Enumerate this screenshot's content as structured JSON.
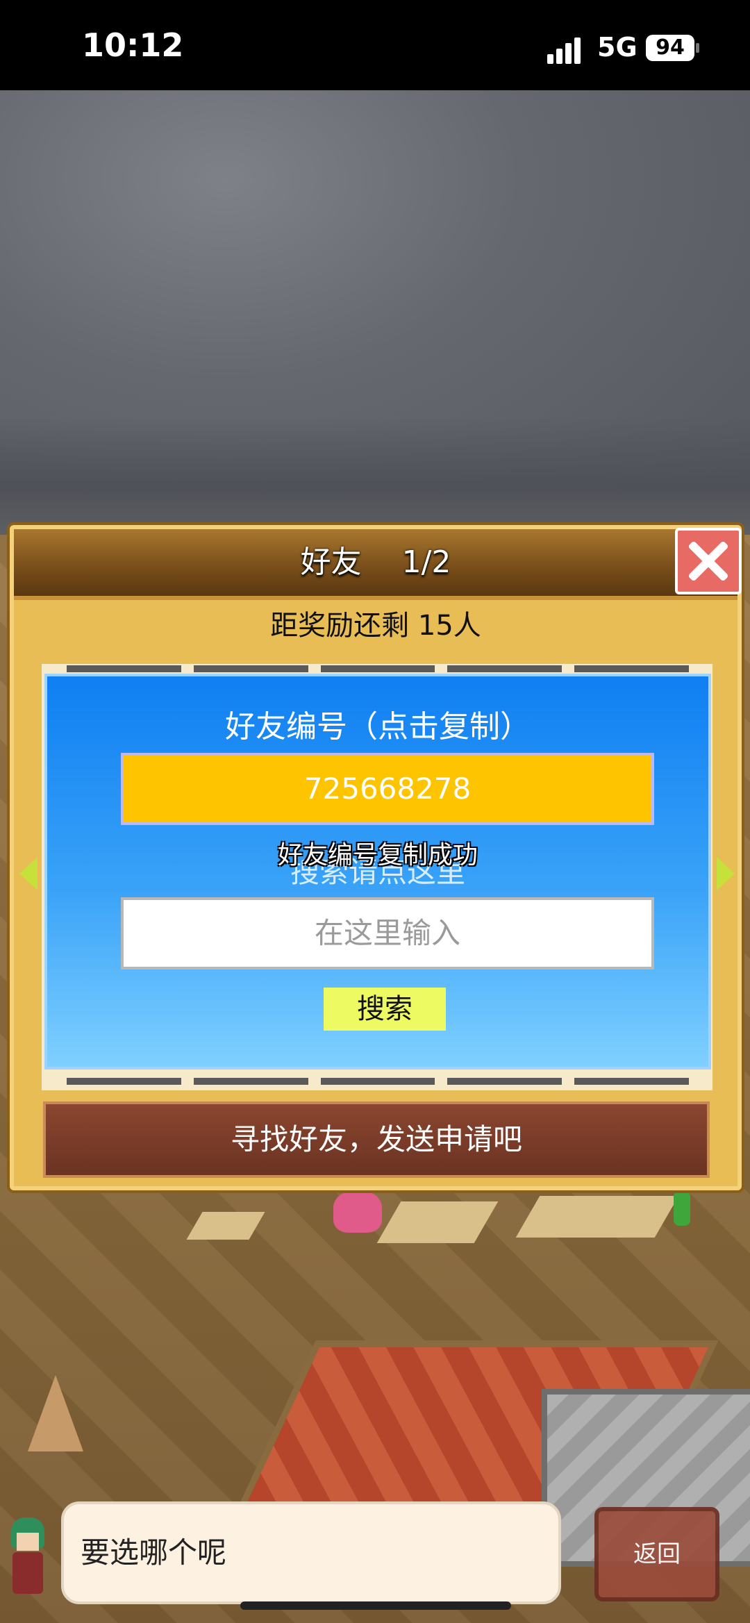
{
  "status_bar": {
    "time": "10:12",
    "network": "5G",
    "battery": "94"
  },
  "dialog": {
    "title": "好友　 1/2",
    "remaining": "距奖励还剩 15人",
    "friend_id_label": "好友编号（点击复制）",
    "friend_id": "725668278",
    "copy_toast": "好友编号复制成功",
    "search_hint": "搜索请点这里",
    "search_placeholder": "在这里输入",
    "search_button": "搜索",
    "find_friends_button": "寻找好友，发送申请吧"
  },
  "bottom": {
    "speech": "要选哪个呢",
    "back_button": "返回"
  },
  "colors": {
    "friend_id_bg": "#ffc400",
    "panel_top": "#0f7ff2",
    "search_button": "#eefa62",
    "close_button": "#e86a64"
  }
}
